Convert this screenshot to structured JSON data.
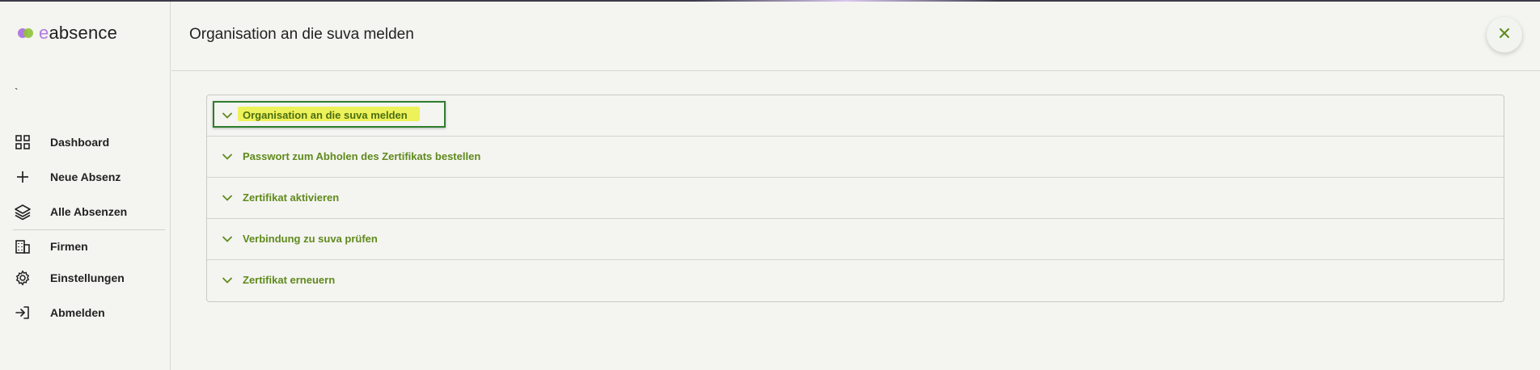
{
  "app": {
    "logo_prefix": "e",
    "logo_rest": "absence"
  },
  "sidebar": {
    "tilde": "`",
    "items": [
      {
        "label": "Dashboard",
        "icon": "grid-icon"
      },
      {
        "label": "Neue Absenz",
        "icon": "plus-icon"
      },
      {
        "label": "Alle Absenzen",
        "icon": "layers-icon"
      },
      {
        "label": "Firmen",
        "icon": "building-icon"
      },
      {
        "label": "Einstellungen",
        "icon": "gear-icon"
      },
      {
        "label": "Abmelden",
        "icon": "logout-icon"
      }
    ]
  },
  "header": {
    "title": "Organisation an die suva melden",
    "close_icon": "close-icon"
  },
  "accordion": {
    "items": [
      {
        "label": "Organisation an die suva melden",
        "highlighted": true
      },
      {
        "label": "Passwort zum Abholen des Zertifikats bestellen"
      },
      {
        "label": "Zertifikat aktivieren"
      },
      {
        "label": "Verbindung zu suva prüfen"
      },
      {
        "label": "Zertifikat erneuern"
      }
    ]
  },
  "colors": {
    "accent_green": "#5f8a1c",
    "highlight_yellow": "#eef25a",
    "highlight_border": "#2e7d2e",
    "logo_purple": "#b07be0",
    "background": "#f4f4f0"
  }
}
